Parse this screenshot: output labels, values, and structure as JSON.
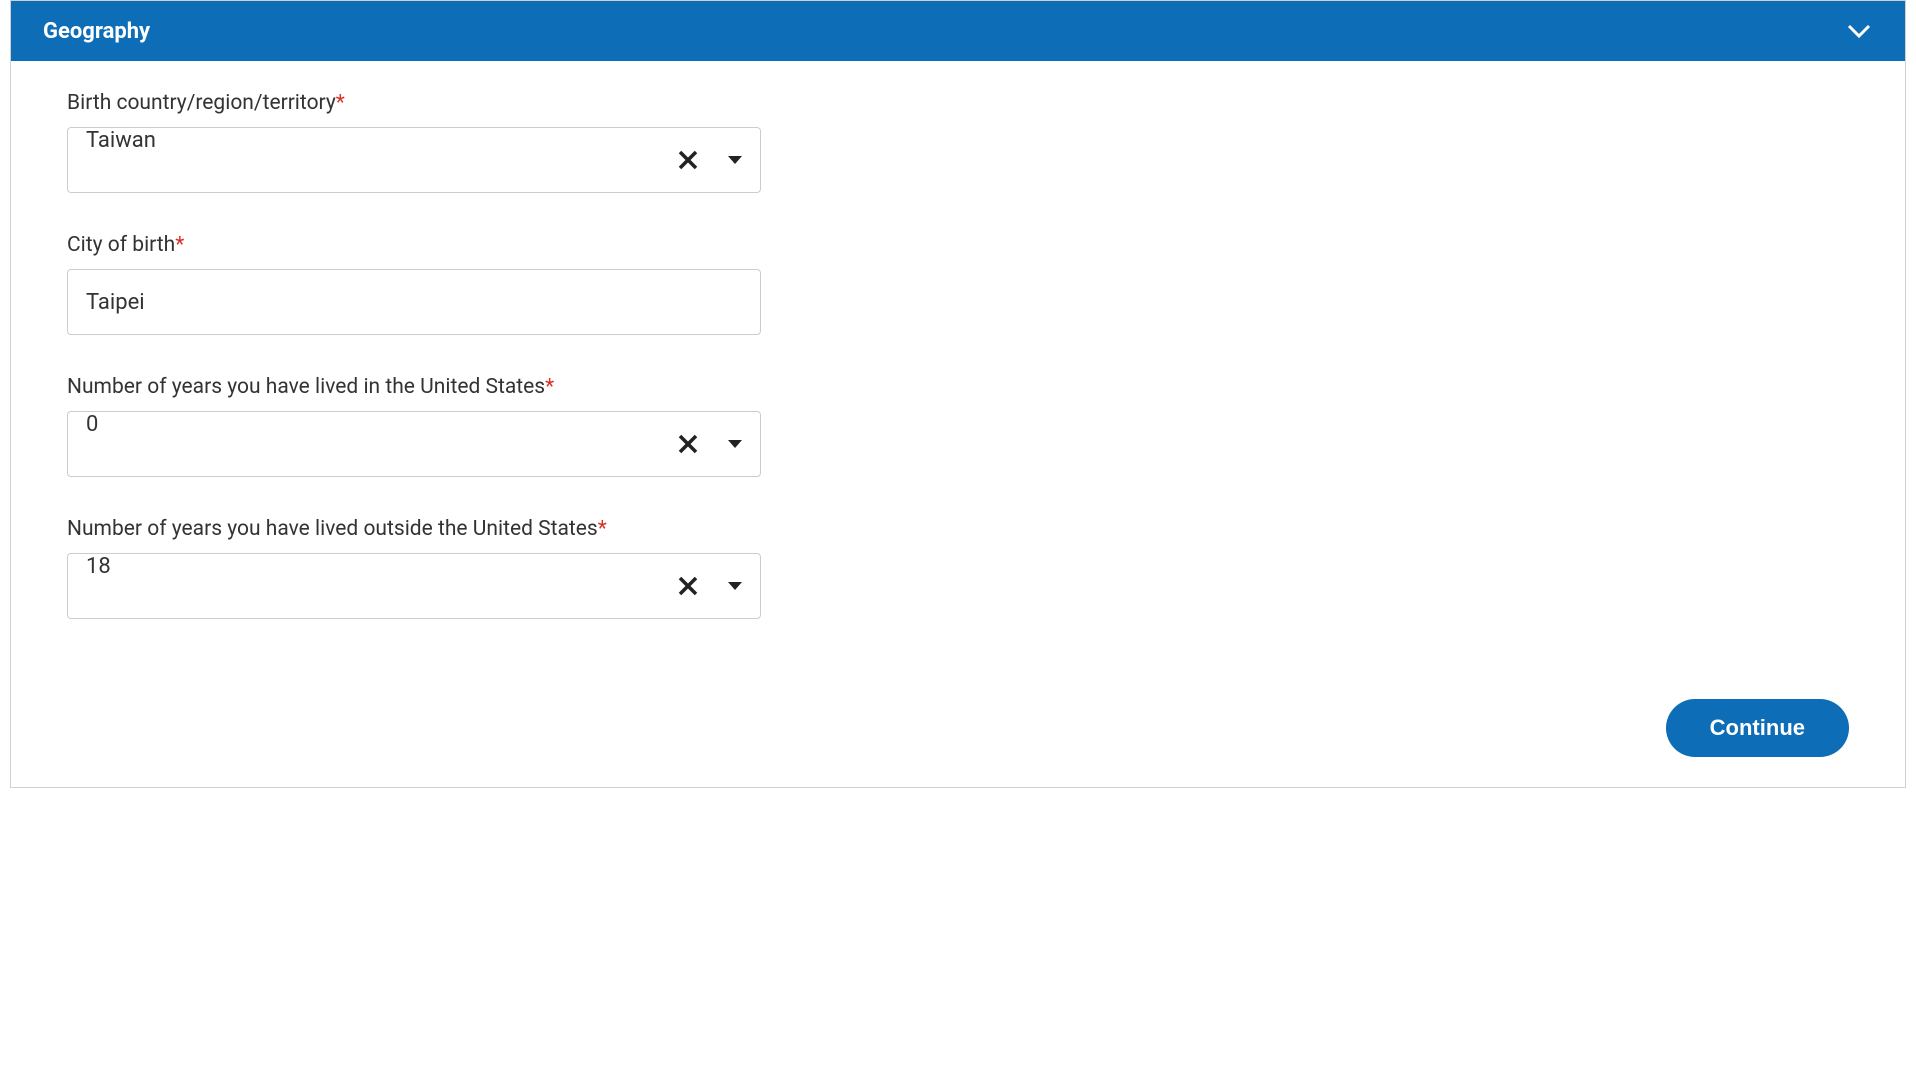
{
  "section": {
    "title": "Geography"
  },
  "fields": {
    "birth_country": {
      "label": "Birth country/region/territory",
      "required": "*",
      "value": "Taiwan"
    },
    "city_of_birth": {
      "label": "City of birth",
      "required": "*",
      "value": "Taipei"
    },
    "years_in_us": {
      "label": "Number of years you have lived in the United States",
      "required": "*",
      "value": "0"
    },
    "years_outside_us": {
      "label": "Number of years you have lived outside the United States",
      "required": "*",
      "value": "18"
    }
  },
  "actions": {
    "continue_label": "Continue"
  }
}
